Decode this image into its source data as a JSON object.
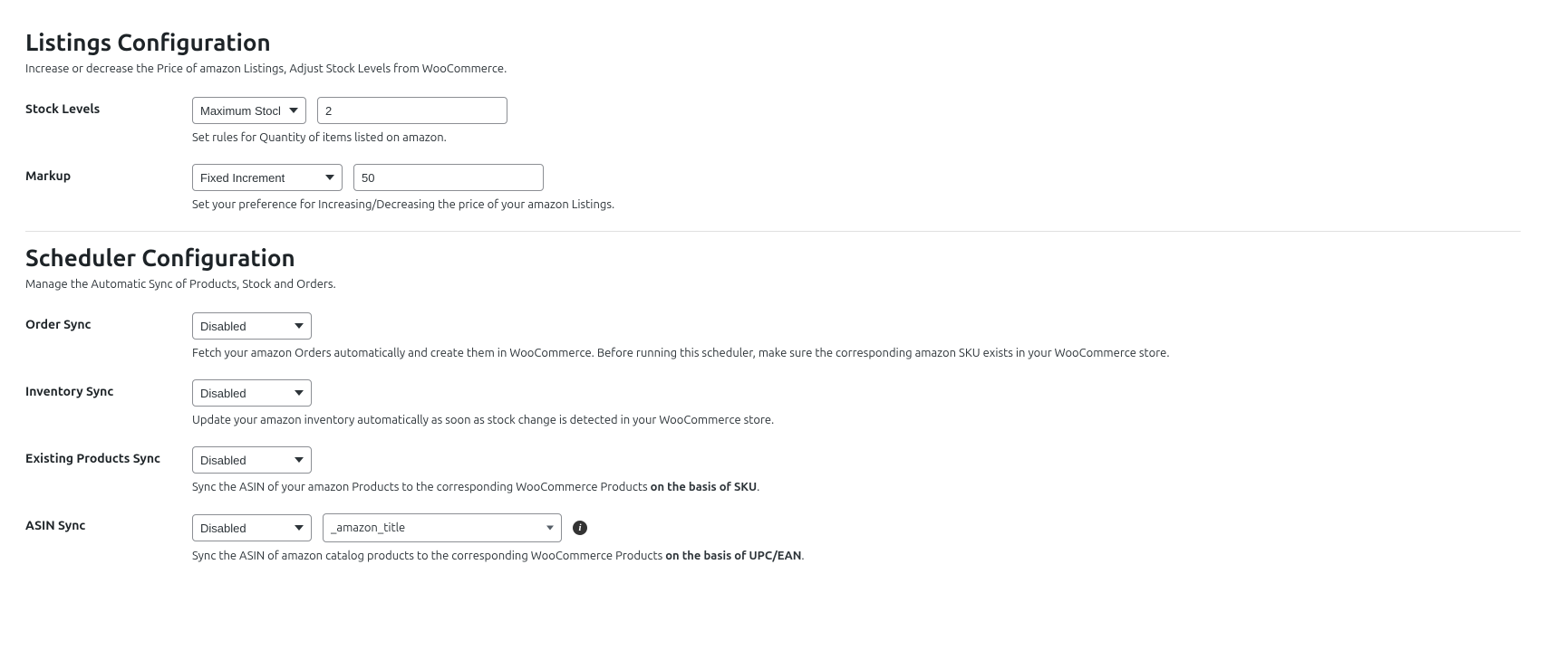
{
  "listings": {
    "title": "Listings Configuration",
    "desc": "Increase or decrease the Price of amazon Listings, Adjust Stock Levels from WooCommerce.",
    "stock_levels": {
      "label": "Stock Levels",
      "select_value": "Maximum Stock",
      "input_value": "2",
      "help": "Set rules for Quantity of items listed on amazon."
    },
    "markup": {
      "label": "Markup",
      "select_value": "Fixed Increment",
      "input_value": "50",
      "help": "Set your preference for Increasing/Decreasing the price of your amazon Listings."
    }
  },
  "scheduler": {
    "title": "Scheduler Configuration",
    "desc": "Manage the Automatic Sync of Products, Stock and Orders.",
    "order_sync": {
      "label": "Order Sync",
      "value": "Disabled",
      "help": "Fetch your amazon Orders automatically and create them in WooCommerce. Before running this scheduler, make sure the corresponding amazon SKU exists in your WooCommerce store."
    },
    "inventory_sync": {
      "label": "Inventory Sync",
      "value": "Disabled",
      "help": "Update your amazon inventory automatically as soon as stock change is detected in your WooCommerce store."
    },
    "existing_products_sync": {
      "label": "Existing Products Sync",
      "value": "Disabled",
      "help_pre": "Sync the ASIN of your amazon Products to the corresponding WooCommerce Products ",
      "help_bold": "on the basis of SKU",
      "help_post": "."
    },
    "asin_sync": {
      "label": "ASIN Sync",
      "value": "Disabled",
      "field_value": "_amazon_title",
      "help_pre": "Sync the ASIN of amazon catalog products to the corresponding WooCommerce Products ",
      "help_bold": "on the basis of UPC/EAN",
      "help_post": "."
    }
  }
}
